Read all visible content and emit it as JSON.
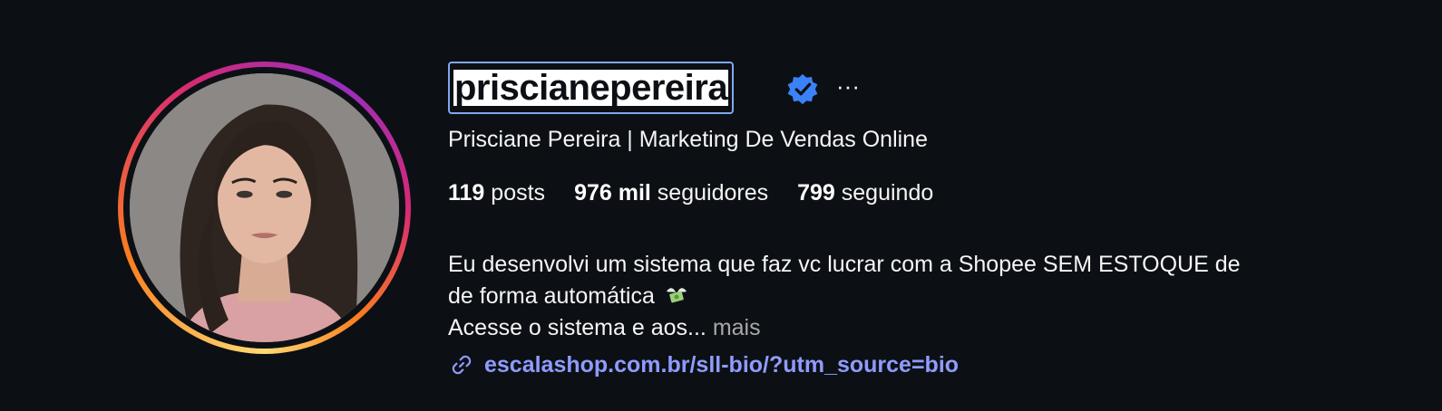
{
  "profile": {
    "username": "priscianepereira",
    "full_name": "Prisciane Pereira | Marketing De Vendas Online",
    "verified_icon": "verified-badge-icon",
    "more_options": "···",
    "stats": {
      "posts_value": "119",
      "posts_label": "posts",
      "followers_value": "976 mil",
      "followers_label": "seguidores",
      "following_value": "799",
      "following_label": "seguindo"
    },
    "bio": {
      "line1": "Eu desenvolvi um sistema que faz vc lucrar com a Shopee SEM ESTOQUE de",
      "line2": "de forma automática",
      "line2_emoji": "money-with-wings-emoji",
      "line3": "Acesse o sistema e aos...",
      "more": "mais"
    },
    "link": {
      "icon": "link-icon",
      "text": "escalashop.com.br/sll-bio/?utm_source=bio"
    }
  },
  "colors": {
    "background": "#0c1014",
    "verified": "#3b82f6",
    "link": "#8f9bff",
    "muted": "#a8a8a8",
    "selection_border": "#7fa8f0"
  }
}
